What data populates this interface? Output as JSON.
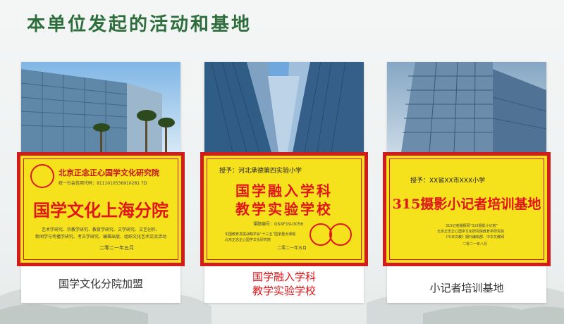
{
  "page_title": "本单位发起的活动和基地",
  "cards": [
    {
      "org_name": "北京正念正心国学文化研究院",
      "org_code": "统一社会信用代码：9111010536910281 7D",
      "main_title": "国学文化上海分院",
      "desc_line1": "艺术学研究、宗教学研究、教育学研究、文学研究、文艺创作、",
      "desc_line2": "新闻学与传播学研究、考古学研究、编辑出版、组织文化艺术交流活动",
      "date": "二零二一年五月",
      "caption": "国学文化分院加盟"
    },
    {
      "grantee": "授予：河北承德第四实验小学",
      "main_title_1": "国学融入学科",
      "main_title_2": "教学实验学校",
      "project_no": "课题编号：GSXF19-0056",
      "small_line1": "中国教育发展战略学会“十三五”国家重点课题",
      "small_line2": "北京正念正心国学文化研究院",
      "date": "二零二一年五月",
      "caption_line1": "国学融入学科",
      "caption_line2": "教学实验学校"
    },
    {
      "grantee": "授予：XX省XX市XXX小学",
      "main_title": "315摄影小记者培训基地",
      "small_line1": "315记者播报网“315摄影小记者”",
      "small_line2": "北京正念正心国学文化研究院教育学研究院",
      "small_line3": "《今日文教》期刊编辑部、中华文教网",
      "date": "二零二一年八月",
      "caption": "小记者培训基地"
    }
  ]
}
